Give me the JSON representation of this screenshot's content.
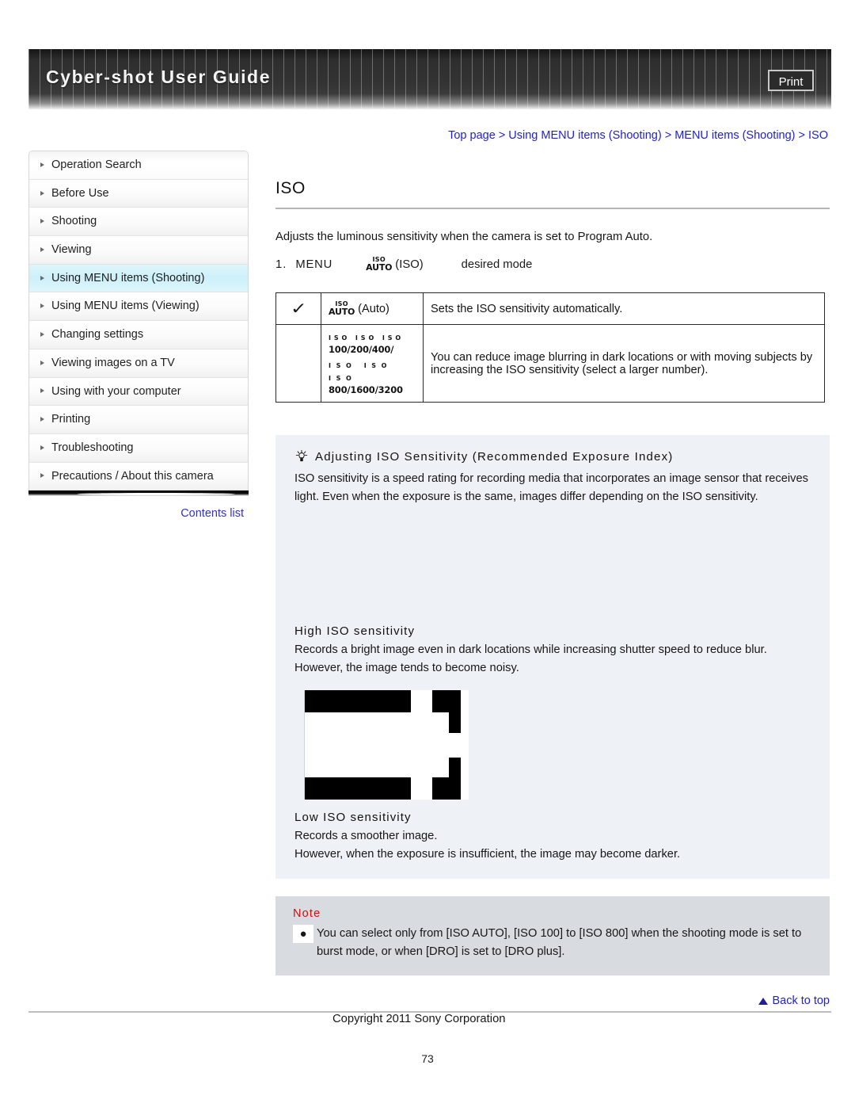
{
  "header": {
    "title": "Cyber-shot User Guide",
    "print_label": "Print"
  },
  "breadcrumb": {
    "text": "Top page > Using MENU items (Shooting) > MENU items (Shooting) > ISO"
  },
  "sidebar": {
    "items": [
      {
        "label": "Operation Search",
        "active": false
      },
      {
        "label": "Before Use",
        "active": false
      },
      {
        "label": "Shooting",
        "active": false
      },
      {
        "label": "Viewing",
        "active": false
      },
      {
        "label": "Using MENU items (Shooting)",
        "active": true
      },
      {
        "label": "Using MENU items (Viewing)",
        "active": false
      },
      {
        "label": "Changing settings",
        "active": false
      },
      {
        "label": "Viewing images on a TV",
        "active": false
      },
      {
        "label": "Using with your computer",
        "active": false
      },
      {
        "label": "Printing",
        "active": false
      },
      {
        "label": "Troubleshooting",
        "active": false
      },
      {
        "label": "Precautions / About this camera",
        "active": false
      }
    ],
    "contents_list_label": "Contents list"
  },
  "main": {
    "page_title": "ISO",
    "intro": "Adjusts the luminous sensitivity when the camera is set to Program Auto.",
    "step": {
      "number": "1.",
      "menu_label": "MENU",
      "icon_top": "ISO",
      "icon_bottom": "AUTO",
      "icon_caption": "(ISO)",
      "target": "desired mode"
    },
    "table": {
      "rows": [
        {
          "checked": "✓",
          "icon_top": "ISO",
          "icon_bottom": "AUTO",
          "icon_caption": "(Auto)",
          "description": "Sets the ISO sensitivity automatically."
        },
        {
          "checked": "",
          "icon_line1_small": "ISO ISO ISO",
          "icon_line1_big": "100/200/400/",
          "icon_line2_small": "ISO  ISO  ISO",
          "icon_line2_big": "800/1600/3200",
          "description": "You can reduce image blurring in dark locations or with moving subjects by increasing the ISO sensitivity (select a larger number)."
        }
      ]
    },
    "tip": {
      "icon": "lightbulb-icon",
      "title": "Adjusting ISO Sensitivity (Recommended Exposure Index)",
      "body": "ISO sensitivity is a speed rating for recording media that incorporates an image sensor that receives light. Even when the exposure is the same, images differ depending on the ISO sensitivity."
    },
    "high_iso": {
      "title": "High ISO sensitivity",
      "body": "Records a bright image even in dark locations while increasing shutter speed to reduce blur. However, the image tends to become noisy."
    },
    "low_iso": {
      "title": "Low ISO sensitivity",
      "line1": "Records a smoother image.",
      "line2": "However, when the exposure is insufficient, the image may become darker."
    },
    "note": {
      "title": "Note",
      "bullet": "●",
      "text": "You can select only from [ISO AUTO], [ISO 100] to [ISO 800] when the shooting mode is set to burst mode, or when [DRO] is set to [DRO plus]."
    }
  },
  "footer": {
    "back_to_top": "Back to top",
    "copyright": "Copyright 2011 Sony Corporation",
    "page_number": "73"
  },
  "colors": {
    "link": "#2222cc",
    "note_title": "#d01010",
    "tip_bg": "#eef1f5",
    "note_bg": "#d8dbe0",
    "sidebar_active": "#cdf0fa"
  }
}
